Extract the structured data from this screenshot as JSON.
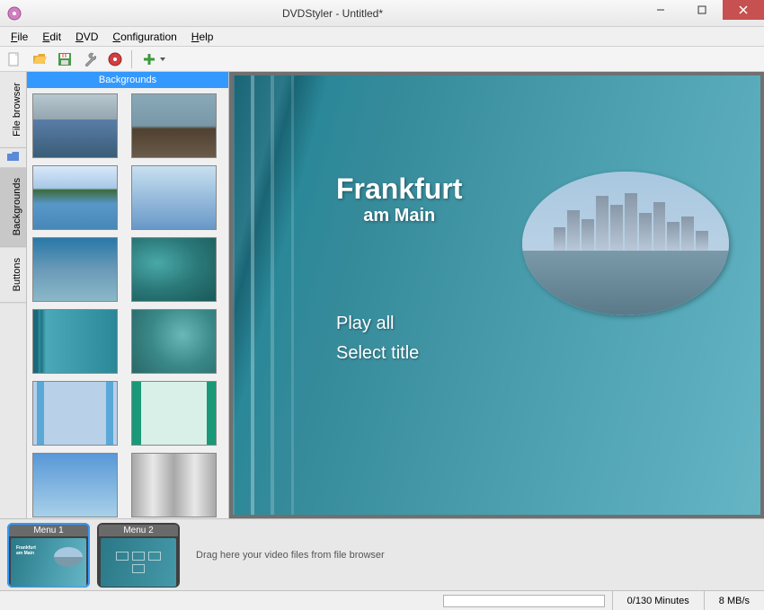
{
  "window": {
    "title": "DVDStyler - Untitled*"
  },
  "menubar": {
    "file": "File",
    "edit": "Edit",
    "dvd": "DVD",
    "configuration": "Configuration",
    "help": "Help"
  },
  "side_tabs": {
    "file_browser": "File browser",
    "backgrounds": "Backgrounds",
    "buttons": "Buttons"
  },
  "bg_panel": {
    "header": "Backgrounds"
  },
  "preview": {
    "title_main": "Frankfurt",
    "title_sub": "am Main",
    "menu_items": {
      "play_all": "Play all",
      "select_title": "Select title"
    }
  },
  "timeline": {
    "menu1_label": "Menu 1",
    "menu2_label": "Menu 2",
    "drag_hint": "Drag here your video files from file browser"
  },
  "statusbar": {
    "duration": "0/130 Minutes",
    "bitrate": "8 MB/s"
  },
  "icons": {
    "new": "new-file-icon",
    "open": "open-folder-icon",
    "save": "save-icon",
    "settings": "settings-icon",
    "burn": "burn-disc-icon",
    "add": "add-icon"
  }
}
